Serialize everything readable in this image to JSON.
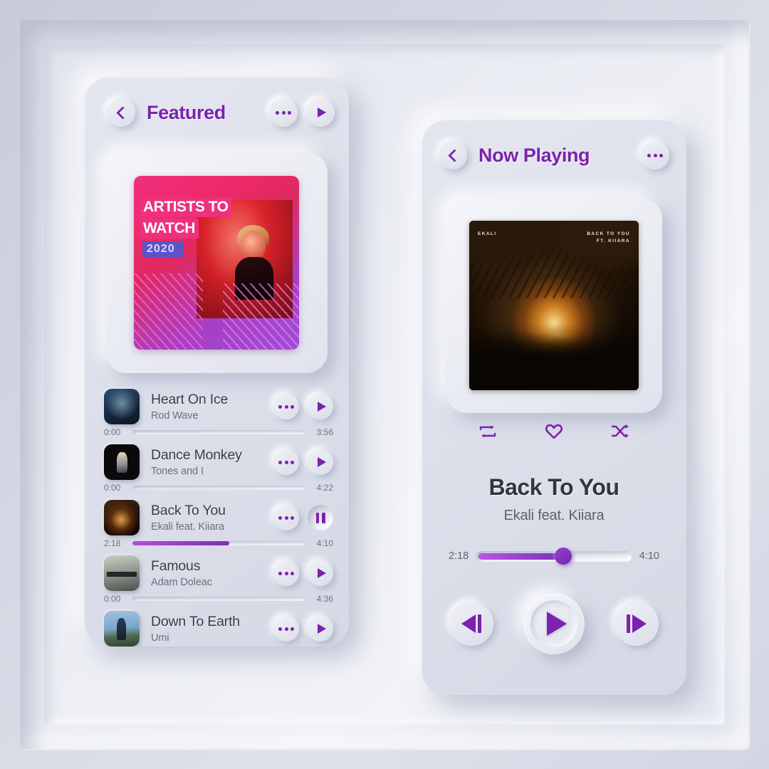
{
  "theme": {
    "accent": "#7b22ae",
    "accent_light": "#b44fd8",
    "surface": "#dde0ea",
    "background": "#d4d7e3",
    "text_primary": "#3a3a42",
    "text_secondary": "#6d6f7b"
  },
  "featured": {
    "title": "Featured",
    "back_icon": "chevron-left-icon",
    "more_icon": "more-options-icon",
    "play_icon": "play-icon",
    "artwork": {
      "line1": "ARTISTS TO",
      "line2": "WATCH",
      "year": "2020"
    },
    "tracks": [
      {
        "title": "Heart On Ice",
        "artist": "Rod Wave",
        "elapsed": "0:00",
        "duration": "3:56",
        "progress_pct": 0,
        "state": "paused",
        "action_icon": "play-icon",
        "thumb_class": "th-heart"
      },
      {
        "title": "Dance Monkey",
        "artist": "Tones and I",
        "elapsed": "0:00",
        "duration": "4:22",
        "progress_pct": 0,
        "state": "paused",
        "action_icon": "play-icon",
        "thumb_class": "th-dance"
      },
      {
        "title": "Back To You",
        "artist": "Ekali feat. Kiiara",
        "elapsed": "2:18",
        "duration": "4:10",
        "progress_pct": 56,
        "state": "playing",
        "action_icon": "pause-icon",
        "thumb_class": "th-back"
      },
      {
        "title": "Famous",
        "artist": "Adam Doleac",
        "elapsed": "0:00",
        "duration": "4:36",
        "progress_pct": 0,
        "state": "paused",
        "action_icon": "play-icon",
        "thumb_class": "th-famous"
      },
      {
        "title": "Down To Earth",
        "artist": "Umi",
        "elapsed": "",
        "duration": "",
        "progress_pct": 0,
        "state": "paused",
        "action_icon": "play-icon",
        "thumb_class": "th-down"
      }
    ]
  },
  "now_playing": {
    "title": "Now Playing",
    "back_icon": "chevron-left-icon",
    "more_icon": "more-options-icon",
    "artwork": {
      "label_left": "EKALI",
      "label_right_line1": "BACK TO YOU",
      "label_right_line2": "FT. KIIARA"
    },
    "actions": [
      {
        "name": "repeat-icon"
      },
      {
        "name": "heart-icon"
      },
      {
        "name": "shuffle-icon"
      }
    ],
    "track_title": "Back To You",
    "track_artist": "Ekali feat. Kiiara",
    "elapsed": "2:18",
    "duration": "4:10",
    "progress_pct": 56,
    "controls": {
      "previous_icon": "previous-track-icon",
      "play_icon": "play-icon",
      "next_icon": "next-track-icon"
    }
  }
}
